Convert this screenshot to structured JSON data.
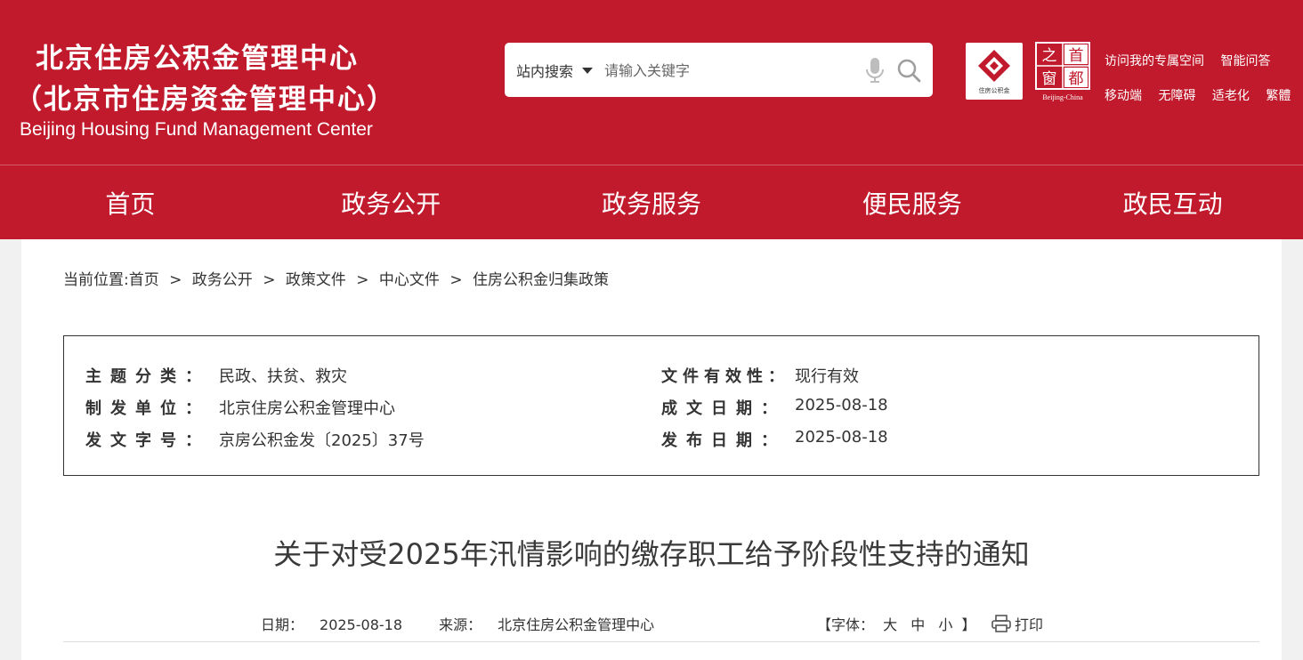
{
  "header": {
    "title_line1": "北京住房公积金管理中心",
    "title_line2": "（北京市住房资金管理中心）",
    "title_en": "Beijing Housing Fund Management Center",
    "search_scope": "站内搜索",
    "search_placeholder": "请输入关键字",
    "logo_fund_caption": "住房公积金",
    "logo_capital_chars": [
      "之",
      "首",
      "窗",
      "都"
    ],
    "logo_capital_en": "Beijing-China",
    "utility_links_row1": [
      "访问我的专属空间",
      "智能问答"
    ],
    "utility_links_row2": [
      "移动端",
      "无障碍",
      "适老化",
      "繁體"
    ]
  },
  "nav": {
    "items": [
      "首页",
      "政务公开",
      "政务服务",
      "便民服务",
      "政民互动"
    ]
  },
  "breadcrumb": {
    "prefix": "当前位置:",
    "items": [
      "首页",
      "政务公开",
      "政策文件",
      "中心文件",
      "住房公积金归集政策"
    ],
    "separator": ">"
  },
  "meta": {
    "left": [
      {
        "label": "主题分类",
        "value": "民政、扶贫、救灾"
      },
      {
        "label": "制发单位",
        "value": "北京住房公积金管理中心"
      },
      {
        "label": "发文字号",
        "value": "京房公积金发〔2025〕37号"
      }
    ],
    "right": [
      {
        "label": "文件有效性",
        "value": "现行有效"
      },
      {
        "label": "成文日期",
        "value": "2025-08-18"
      },
      {
        "label": "发布日期",
        "value": "2025-08-18"
      }
    ],
    "colon": "："
  },
  "article": {
    "title": "关于对受2025年汛情影响的缴存职工给予阶段性支持的通知",
    "date_label": "日期：",
    "date": "2025-08-18",
    "source_label": "来源：",
    "source": "北京住房公积金管理中心",
    "font_label": "【字体：",
    "font_large": "大",
    "font_medium": "中",
    "font_small": "小",
    "font_end": "】",
    "print_label": "打印"
  },
  "colors": {
    "brand_red": "#c01a2c"
  }
}
